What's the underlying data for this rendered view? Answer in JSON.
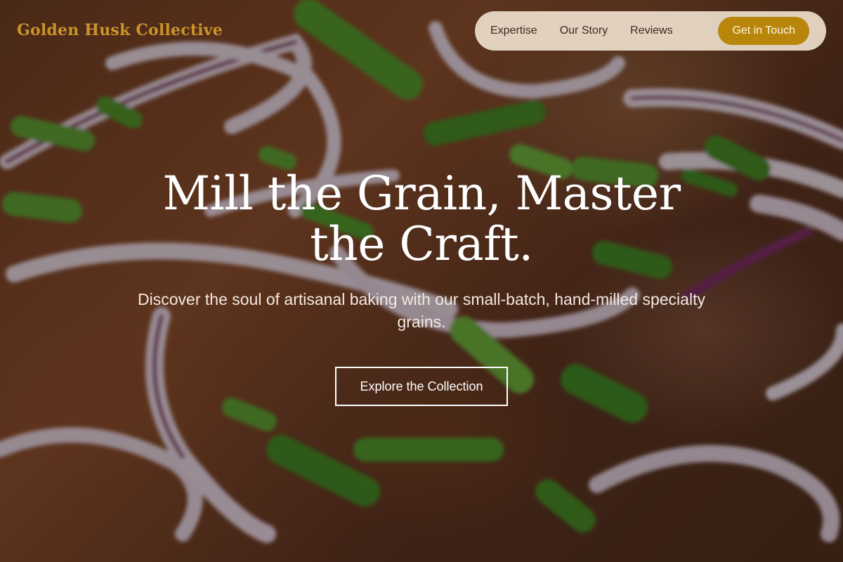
{
  "brand": {
    "name": "Golden Husk Collective",
    "color": "#c9942a"
  },
  "nav": {
    "links": [
      {
        "label": "Expertise"
      },
      {
        "label": "Our Story"
      },
      {
        "label": "Reviews"
      }
    ],
    "cta_label": "Get in Touch",
    "cta_color": "#b8860b"
  },
  "hero": {
    "title": "Mill the Grain, Master the Craft.",
    "subtitle": "Discover the soul of artisanal baking with our small-batch, hand-milled specialty grains.",
    "button_label": "Explore the Collection",
    "background_image": "food-photo-red-onion-scallions-stew"
  }
}
